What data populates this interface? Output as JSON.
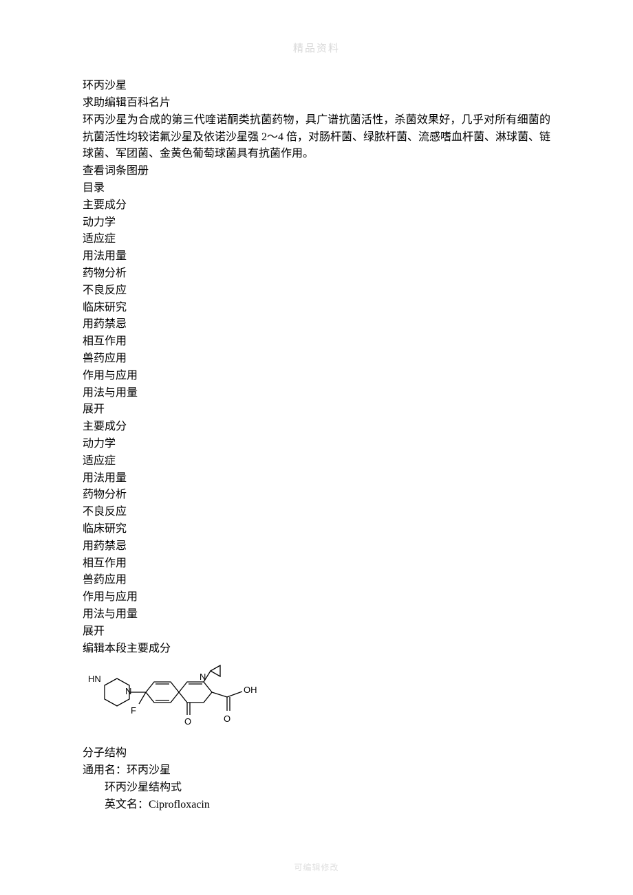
{
  "watermark_top": "精品资料",
  "watermark_bottom": "可编辑修改",
  "title": "环丙沙星",
  "help_line": "求助编辑百科名片",
  "intro": "环丙沙星为合成的第三代喹诺酮类抗菌药物，具广谱抗菌活性，杀菌效果好，几乎对所有细菌的抗菌活性均较诺氟沙星及依诺沙星强 2～4 倍，对肠杆菌、绿脓杆菌、流感嗜血杆菌、淋球菌、链球菌、军团菌、金黄色葡萄球菌具有抗菌作用。",
  "view_album": " 查看词条图册",
  "toc_header": "目录",
  "toc1": [
    "主要成分",
    "动力学",
    "适应症",
    "用法用量",
    "药物分析",
    "不良反应",
    "临床研究",
    "用药禁忌",
    "相互作用",
    "兽药应用",
    "作用与应用",
    "用法与用量",
    "展开"
  ],
  "toc2": [
    "主要成分",
    "动力学",
    "适应症",
    "用法用量",
    "药物分析",
    "不良反应",
    "临床研究",
    "用药禁忌",
    "相互作用",
    "兽药应用",
    "作用与应用",
    "用法与用量",
    "展开"
  ],
  "section_heading": "编辑本段主要成分",
  "structure": {
    "label_HN": "HN",
    "label_N_left": "N",
    "label_N_right": "N",
    "label_F": "F",
    "label_O1": "O",
    "label_O2": "O",
    "label_OH": "OH"
  },
  "mol_struct_label": "分子结构",
  "generic_name_line": "通用名：环丙沙星",
  "struct_formula_line": "环丙沙星结构式",
  "english_name_line": "英文名：Ciprofloxacin"
}
